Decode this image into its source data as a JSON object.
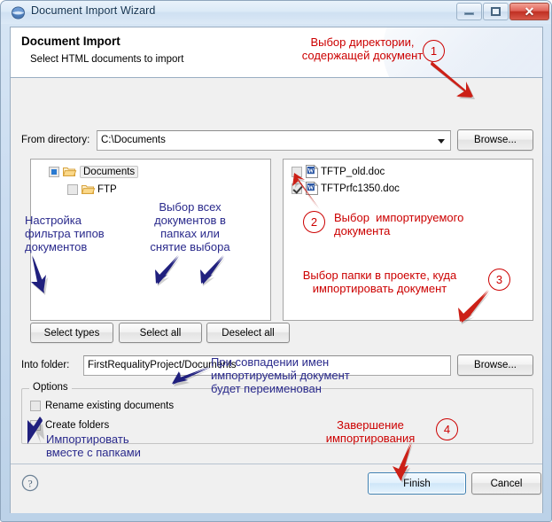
{
  "window": {
    "title": "Document Import Wizard",
    "icon": "eclipse-globe-icon",
    "buttons": {
      "minimize": "minimize-icon",
      "maximize": "maximize-icon",
      "close": "close-icon"
    }
  },
  "banner": {
    "title": "Document Import",
    "subtitle": "Select HTML documents to import"
  },
  "from_directory": {
    "label": "From directory:",
    "value": "C:\\Documents",
    "placeholder": "",
    "browse_label": "Browse..."
  },
  "tree": {
    "items": [
      {
        "label": "Documents",
        "checkbox": "partial",
        "selected": true,
        "indent": 0
      },
      {
        "label": "FTP",
        "checkbox": "unchecked",
        "selected": false,
        "indent": 1
      }
    ]
  },
  "files": {
    "items": [
      {
        "label": "TFTP_old.doc",
        "checkbox": "unchecked"
      },
      {
        "label": "TFTPrfc1350.doc",
        "checkbox": "checked"
      }
    ]
  },
  "selection_buttons": {
    "select_types": "Select types",
    "select_all": "Select all",
    "deselect_all": "Deselect all"
  },
  "into_folder": {
    "label": "Into folder:",
    "value": "FirstRequalityProject/Documents",
    "browse_label": "Browse..."
  },
  "options": {
    "title": "Options",
    "items": [
      {
        "label": "Rename existing documents",
        "checked": false
      },
      {
        "label": "Create folders",
        "checked": false
      }
    ]
  },
  "footer": {
    "help": "help-icon",
    "finish": "Finish",
    "cancel": "Cancel"
  },
  "annotations": {
    "colors": {
      "red": "#cc0000",
      "blue": "#2a2a8c"
    },
    "red": [
      {
        "id": "1",
        "text": "Выбор директории,\nсодержащей документ"
      },
      {
        "id": "2",
        "text": "Выбор  импортируемого\nдокумента"
      },
      {
        "id": "3",
        "text": "Выбор папки в проекте, куда\nимпортировать документ"
      },
      {
        "id": "4",
        "text": "Завершение\nимпортирования"
      }
    ],
    "blue": [
      {
        "text": "Настройка\nфильтра типов\nдокументов"
      },
      {
        "text": "Выбор всех\nдокументов в\nпапках или\nснятие выбора"
      },
      {
        "text": "При совпадении имен\nимпортируемый документ\nбудет переименован"
      },
      {
        "text": "Импортировать\nвместе с папками"
      }
    ]
  }
}
